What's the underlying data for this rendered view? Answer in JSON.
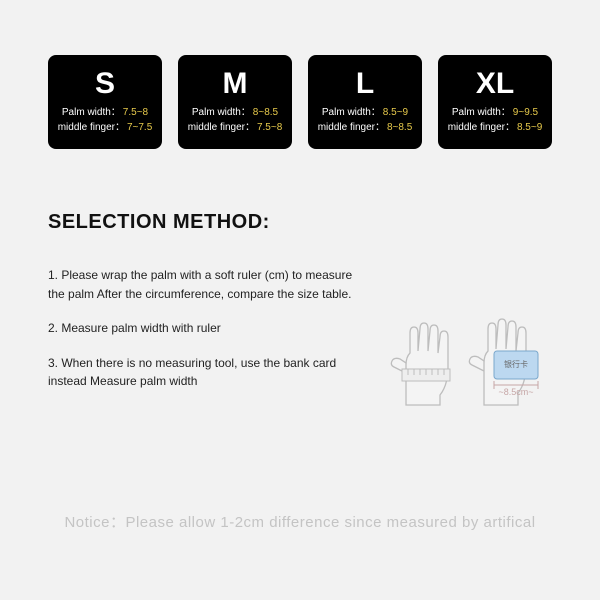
{
  "sizes": [
    {
      "letter": "S",
      "palm_label": "Palm width：",
      "palm_value": "7.5~8",
      "finger_label": "middle finger：",
      "finger_value": "7~7.5"
    },
    {
      "letter": "M",
      "palm_label": "Palm width：",
      "palm_value": "8~8.5",
      "finger_label": "middle finger：",
      "finger_value": "7.5~8"
    },
    {
      "letter": "L",
      "palm_label": "Palm width：",
      "palm_value": "8.5~9",
      "finger_label": "middle finger：",
      "finger_value": "8~8.5"
    },
    {
      "letter": "XL",
      "palm_label": "Palm width：",
      "palm_value": "9~9.5",
      "finger_label": "middle finger：",
      "finger_value": "8.5~9"
    }
  ],
  "section_title": "SELECTION METHOD:",
  "steps": {
    "s1": "1. Please wrap the palm with a soft ruler (cm) to measure the palm After the circumference, compare the size table.",
    "s2": "2. Measure palm width with ruler",
    "s3": "3. When there is no measuring tool, use the bank card instead Measure palm width"
  },
  "illustration": {
    "card_label": "银行卡",
    "width_label": "~8.5cm~"
  },
  "notice": "Notice：Please allow 1-2cm difference since measured by artifical"
}
